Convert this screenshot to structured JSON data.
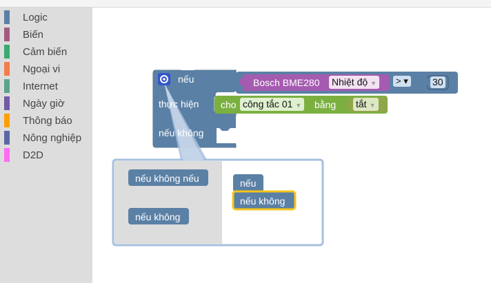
{
  "toolbox": {
    "categories": [
      {
        "label": "Logic",
        "color": "#5b80a5"
      },
      {
        "label": "Biến",
        "color": "#a55b80"
      },
      {
        "label": "Cảm biến",
        "color": "#3aaa70"
      },
      {
        "label": "Ngoại vi",
        "color": "#f47c48"
      },
      {
        "label": "Internet",
        "color": "#5ba58c"
      },
      {
        "label": "Ngày giờ",
        "color": "#745ba5"
      },
      {
        "label": "Thông báo",
        "color": "#ff9f00"
      },
      {
        "label": "Nông nghiệp",
        "color": "#5b67a5"
      },
      {
        "label": "D2D",
        "color": "#ff6bf3"
      }
    ]
  },
  "if_block": {
    "if_label": "nếu",
    "do_label": "thực hiện",
    "else_label": "nếu không",
    "color": "#5b80a5"
  },
  "compare": {
    "operator": "> ▾",
    "value": "30",
    "color": "#5b80a5"
  },
  "sensor": {
    "label": "Bosch BME280",
    "field": "Nhiệt độ",
    "color": "#a55bb0"
  },
  "set_switch": {
    "label_cho": "cho",
    "switch": "công tắc 01",
    "label_bang": "bằng",
    "color": "#7bb040"
  },
  "state": {
    "value": "tắt",
    "color": "#8fa64a"
  },
  "mutator": {
    "flyout": {
      "else_if": "nếu không nếu",
      "else": "nếu không"
    },
    "workspace": {
      "if": "nếu",
      "else": "nếu không"
    }
  }
}
